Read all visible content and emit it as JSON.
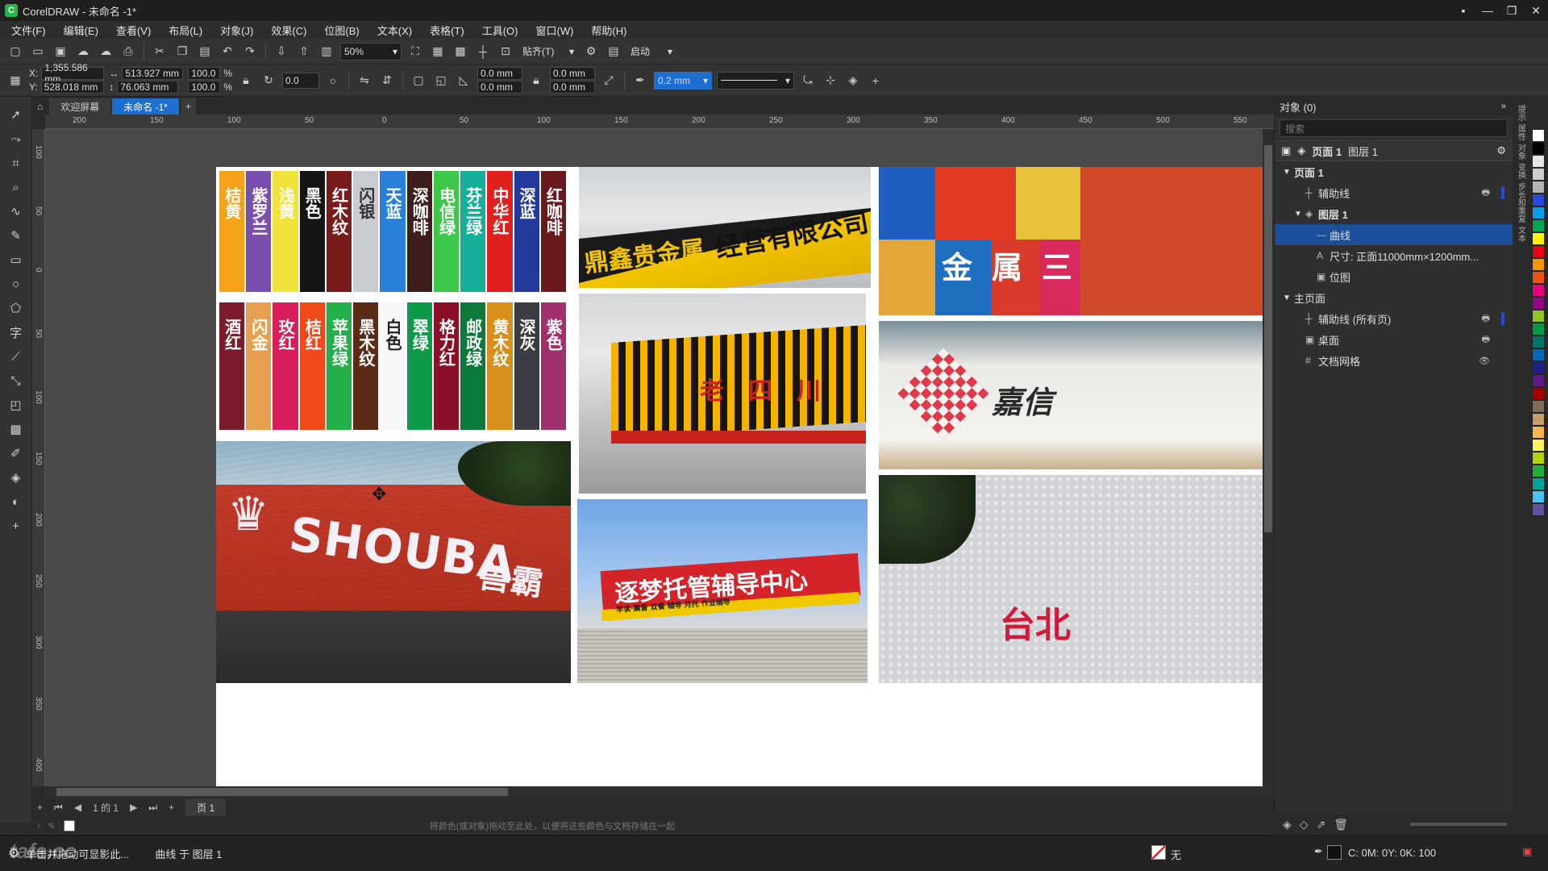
{
  "app": {
    "title": "CorelDRAW - 未命名 -1*",
    "logo_letter": "C"
  },
  "window_controls": [
    "▪",
    "—",
    "❐",
    "✕"
  ],
  "menu": [
    "文件(F)",
    "编辑(E)",
    "查看(V)",
    "布局(L)",
    "对象(J)",
    "效果(C)",
    "位图(B)",
    "文本(X)",
    "表格(T)",
    "工具(O)",
    "窗口(W)",
    "帮助(H)"
  ],
  "toolbar": {
    "zoom": "50%",
    "snap_label": "贴齐(T)",
    "launch_label": "启动"
  },
  "property_bar": {
    "x_label": "X:",
    "x": "1,355.586 mm",
    "y_label": "Y:",
    "y": "528.018 mm",
    "w": "513.927 mm",
    "h": "76.063 mm",
    "scale_w": "100.0",
    "scale_h": "100.0",
    "pct": "%",
    "rotation": "0.0",
    "corner_a": "0.0 mm",
    "corner_b": "0.0 mm",
    "corner_c": "0.0 mm",
    "corner_d": "0.0 mm",
    "outline_width": "0.2 mm"
  },
  "doc_tabs": {
    "welcome": "欢迎屏幕",
    "active": "未命名 -1*",
    "add": "+"
  },
  "ruler": {
    "h_ticks": [
      "200",
      "150",
      "100",
      "50",
      "0",
      "50",
      "100",
      "150",
      "200",
      "250",
      "300",
      "350",
      "400",
      "450",
      "500",
      "550"
    ],
    "v_ticks": [
      "100",
      "50",
      "0",
      "50",
      "100",
      "150",
      "200",
      "250",
      "300",
      "350",
      "400"
    ]
  },
  "page_nav": {
    "page_count": "1 的 1",
    "add": "+",
    "page_label": "页 1"
  },
  "hint": "将颜色(或对象)拖动至此处，以便将这些颜色与文档存储在一起",
  "status": {
    "left": "单击并拖动可显影此...",
    "object": "曲线 于 图层 1",
    "fill_label": "无",
    "color_info": "C: 0M: 0Y: 0K: 100"
  },
  "docker": {
    "title": "对象 (0)",
    "search_placeholder": "搜索",
    "page_label": "页面 1",
    "layer_label": "图层 1",
    "tree": [
      {
        "label": "页面 1",
        "indent": 0,
        "arrow": "▼",
        "bold": true
      },
      {
        "label": "辅助线",
        "indent": 1,
        "icon": "┼",
        "lock": true,
        "color": "#2a48d8"
      },
      {
        "label": "图层 1",
        "indent": 1,
        "arrow": "▼",
        "icon": "◈",
        "bold": true
      },
      {
        "label": "曲线",
        "indent": 2,
        "icon": "—",
        "selected": true
      },
      {
        "label": "尺寸:   正面11000mm×1200mm...",
        "indent": 2,
        "icon": "A"
      },
      {
        "label": "位图",
        "indent": 2,
        "icon": "▣"
      },
      {
        "label": "主页面",
        "indent": 0,
        "arrow": "▼"
      },
      {
        "label": "辅助线 (所有页)",
        "indent": 1,
        "icon": "┼",
        "lock": true,
        "color": "#2a48d8"
      },
      {
        "label": "桌面",
        "indent": 1,
        "icon": "▣",
        "lock": true
      },
      {
        "label": "文档网格",
        "indent": 1,
        "icon": "#",
        "eye": true
      }
    ]
  },
  "side_tabs": [
    "提示",
    "属性",
    "对象",
    "变换",
    "步长和重复",
    "文本"
  ],
  "palette": [
    "#ffffff",
    "#000000",
    "#e6e6e6",
    "#cccccc",
    "#b3b3b3",
    "#2a48d8",
    "#00a0e9",
    "#00a650",
    "#fff100",
    "#e60012",
    "#f39800",
    "#ea5413",
    "#e4007f",
    "#920783",
    "#8fc31f",
    "#009944",
    "#00736d",
    "#0068b7",
    "#1d2088",
    "#601986",
    "#a40000",
    "#7e6b5a",
    "#c69c6d",
    "#f8b551",
    "#fff45c",
    "#b5d100",
    "#22ac38",
    "#00a497",
    "#48c3f1",
    "#5f52a0"
  ],
  "canvas_images": {
    "swatch_row1": [
      {
        "label": "桔黄",
        "color": "#f4a21a",
        "text": "#ffffff"
      },
      {
        "label": "紫罗兰",
        "color": "#7b4fb0",
        "text": "#ffffff"
      },
      {
        "label": "浅黄",
        "color": "#f2e23c",
        "text": "#ffffff"
      },
      {
        "label": "黑色",
        "color": "#151515",
        "text": "#ffffff"
      },
      {
        "label": "红木纹",
        "color": "#7a1b1b",
        "text": "#ffffff"
      },
      {
        "label": "闪银",
        "color": "#c8ccd0",
        "text": "#333333"
      },
      {
        "label": "天蓝",
        "color": "#2a7fd8",
        "text": "#ffffff"
      },
      {
        "label": "深咖啡",
        "color": "#3d1e1a",
        "text": "#ffffff"
      },
      {
        "label": "电信绿",
        "color": "#3dc84a",
        "text": "#ffffff"
      },
      {
        "label": "芬兰绿",
        "color": "#16b09a",
        "text": "#ffffff"
      },
      {
        "label": "中华红",
        "color": "#e0201e",
        "text": "#ffffff"
      },
      {
        "label": "深蓝",
        "color": "#233a9c",
        "text": "#ffffff"
      },
      {
        "label": "红咖啡",
        "color": "#6a1a1c",
        "text": "#ffffff"
      }
    ],
    "swatch_row2": [
      {
        "label": "酒红",
        "color": "#7a1c2c",
        "text": "#ffffff"
      },
      {
        "label": "闪金",
        "color": "#e6a050",
        "text": "#ffffff"
      },
      {
        "label": "玫红",
        "color": "#d81e5b",
        "text": "#ffffff"
      },
      {
        "label": "桔红",
        "color": "#f04a1a",
        "text": "#ffffff"
      },
      {
        "label": "苹果绿",
        "color": "#23b04a",
        "text": "#ffffff"
      },
      {
        "label": "黑木纹",
        "color": "#5a2c18",
        "text": "#ffffff"
      },
      {
        "label": "白色",
        "color": "#f8f8f8",
        "text": "#222222"
      },
      {
        "label": "翠绿",
        "color": "#0f9a4a",
        "text": "#ffffff"
      },
      {
        "label": "格力红",
        "color": "#8a1028",
        "text": "#ffffff"
      },
      {
        "label": "邮政绿",
        "color": "#0b7a3a",
        "text": "#ffffff"
      },
      {
        "label": "黄木纹",
        "color": "#d8901c",
        "text": "#ffffff"
      },
      {
        "label": "深灰",
        "color": "#3c3c44",
        "text": "#ffffff"
      },
      {
        "label": "紫色",
        "color": "#a0306e",
        "text": "#ffffff"
      }
    ],
    "sign1_left": "鼎鑫贵金属",
    "sign1_right": "经营有限公司",
    "sign2": "老四川",
    "sign3_a": "金",
    "sign3_b": "属",
    "sign3_c": "三",
    "sign4": "嘉信",
    "sign5_en": "SHOUBA",
    "sign5_cn": "兽霸",
    "sign6": "逐梦托管辅导中心",
    "sign6_sub": "早读·晨督 双餐 辅导 月托 作业辅导",
    "sign7": "台北"
  },
  "watermark": "tafe.cc"
}
